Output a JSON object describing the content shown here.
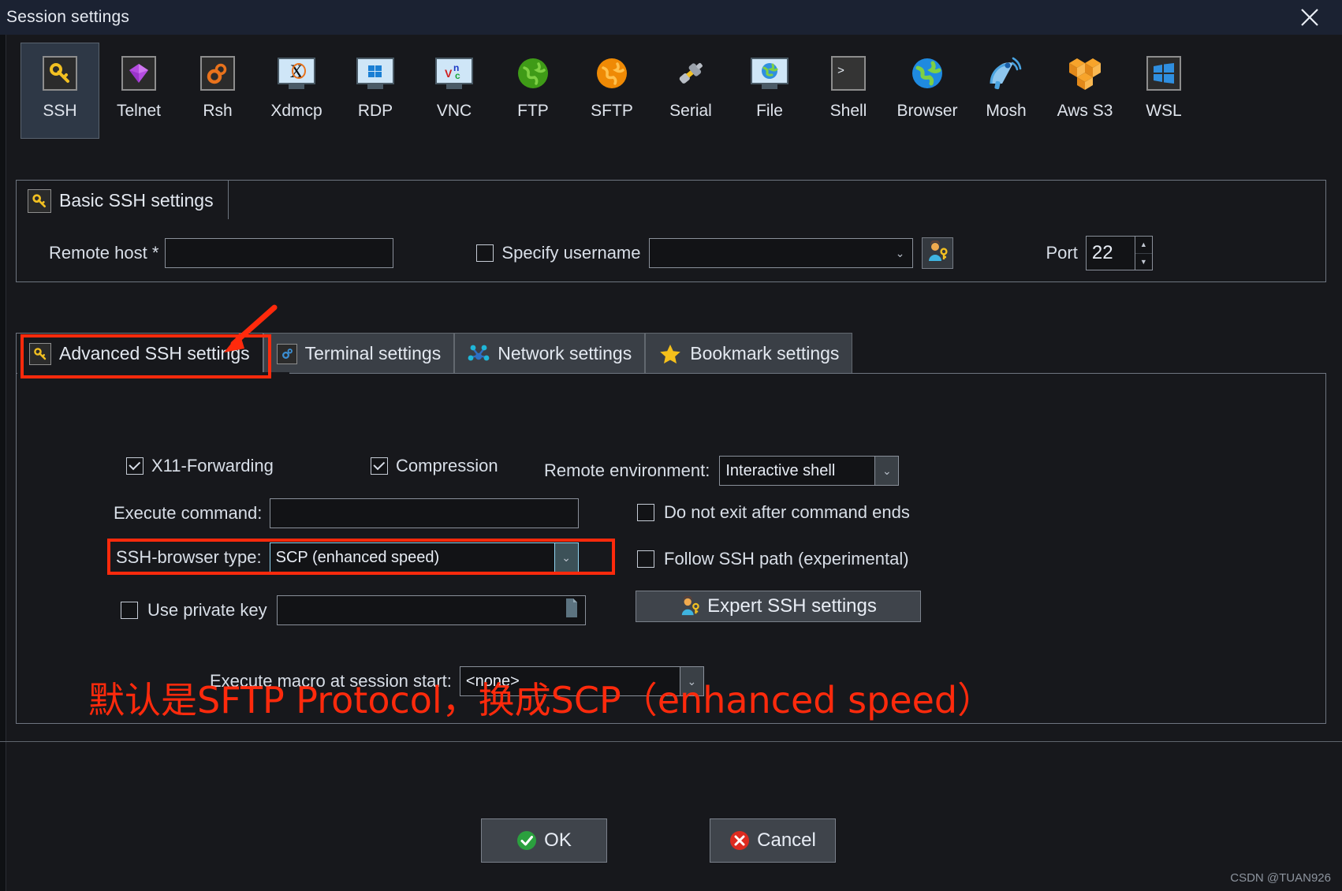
{
  "window": {
    "title": "Session settings",
    "close_label": "✕"
  },
  "protocols": [
    {
      "label": "SSH",
      "icon": "key-icon",
      "selected": true
    },
    {
      "label": "Telnet",
      "icon": "gem-icon",
      "selected": false
    },
    {
      "label": "Rsh",
      "icon": "gears-icon",
      "selected": false
    },
    {
      "label": "Xdmcp",
      "icon": "x-monitor-icon",
      "selected": false
    },
    {
      "label": "RDP",
      "icon": "windows-monitor-icon",
      "selected": false
    },
    {
      "label": "VNC",
      "icon": "vnc-monitor-icon",
      "selected": false
    },
    {
      "label": "FTP",
      "icon": "green-globe-icon",
      "selected": false
    },
    {
      "label": "SFTP",
      "icon": "orange-globe-icon",
      "selected": false
    },
    {
      "label": "Serial",
      "icon": "plug-icon",
      "selected": false
    },
    {
      "label": "File",
      "icon": "globe-monitor-icon",
      "selected": false
    },
    {
      "label": "Shell",
      "icon": "terminal-icon",
      "selected": false
    },
    {
      "label": "Browser",
      "icon": "blue-globe-icon",
      "selected": false
    },
    {
      "label": "Mosh",
      "icon": "satellite-icon",
      "selected": false
    },
    {
      "label": "Aws S3",
      "icon": "aws-cubes-icon",
      "selected": false
    },
    {
      "label": "WSL",
      "icon": "windows-icon",
      "selected": false
    }
  ],
  "basic": {
    "group_title": "Basic SSH settings",
    "remote_host_label": "Remote host *",
    "remote_host_value": "",
    "specify_username_label": "Specify username",
    "specify_username_checked": false,
    "username_value": "",
    "port_label": "Port",
    "port_value": "22"
  },
  "tabs": [
    {
      "label": "Advanced SSH settings",
      "icon": "key-icon",
      "active": true
    },
    {
      "label": "Terminal settings",
      "icon": "gear-blue-icon",
      "active": false
    },
    {
      "label": "Network settings",
      "icon": "network-icon",
      "active": false
    },
    {
      "label": "Bookmark settings",
      "icon": "star-icon",
      "active": false
    }
  ],
  "advanced": {
    "x11_label": "X11-Forwarding",
    "x11_checked": true,
    "compression_label": "Compression",
    "compression_checked": true,
    "remote_env_label": "Remote environment:",
    "remote_env_value": "Interactive shell",
    "execute_command_label": "Execute command:",
    "execute_command_value": "",
    "do_not_exit_label": "Do not exit after command ends",
    "do_not_exit_checked": false,
    "ssh_browser_label": "SSH-browser type:",
    "ssh_browser_value": "SCP (enhanced speed)",
    "follow_ssh_path_label": "Follow SSH path (experimental)",
    "follow_ssh_path_checked": false,
    "use_private_key_label": "Use private key",
    "use_private_key_checked": false,
    "private_key_value": "",
    "expert_button_label": "Expert SSH settings",
    "macro_label": "Execute macro at session start:",
    "macro_value": "<none>"
  },
  "annotation": {
    "chinese_note": "默认是SFTP Protocol，换成SCP（enhanced speed）",
    "highlight_color": "#ff2a0c"
  },
  "footer": {
    "ok_label": "OK",
    "cancel_label": "Cancel",
    "watermark": "CSDN @TUAN926"
  }
}
